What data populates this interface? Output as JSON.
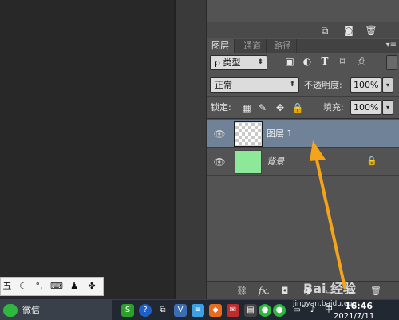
{
  "panel_actions": {
    "icons": [
      "new-group-icon",
      "camera-icon",
      "trash-icon"
    ]
  },
  "tabs": [
    "图层",
    "通道",
    "路径"
  ],
  "filter": {
    "kind_label": "ρ 类型",
    "icons": [
      "image-filter-icon",
      "adjustment-filter-icon",
      "text-filter-icon",
      "shape-filter-icon",
      "smart-object-filter-icon"
    ]
  },
  "blend": {
    "mode": "正常",
    "opacity_label": "不透明度:",
    "opacity_value": "100%"
  },
  "lock": {
    "label": "锁定:",
    "fill_label": "填充:",
    "fill_value": "100%"
  },
  "layers": [
    {
      "name": "图层 1",
      "selected": true
    },
    {
      "name": "背景",
      "selected": false,
      "locked": true
    }
  ],
  "bottom_bar": {
    "fx_label": "fx."
  },
  "taskbar": {
    "wechat_label": "微信",
    "time": "16:46",
    "date": "2021/7/11"
  },
  "watermark": {
    "text": "jingyan.baidu.com",
    "logo": "Bai 经验"
  },
  "colors": {
    "accent_arrow": "#f5a41a",
    "selected_layer": "#6f8298",
    "background_thumb": "#8ee89a"
  }
}
